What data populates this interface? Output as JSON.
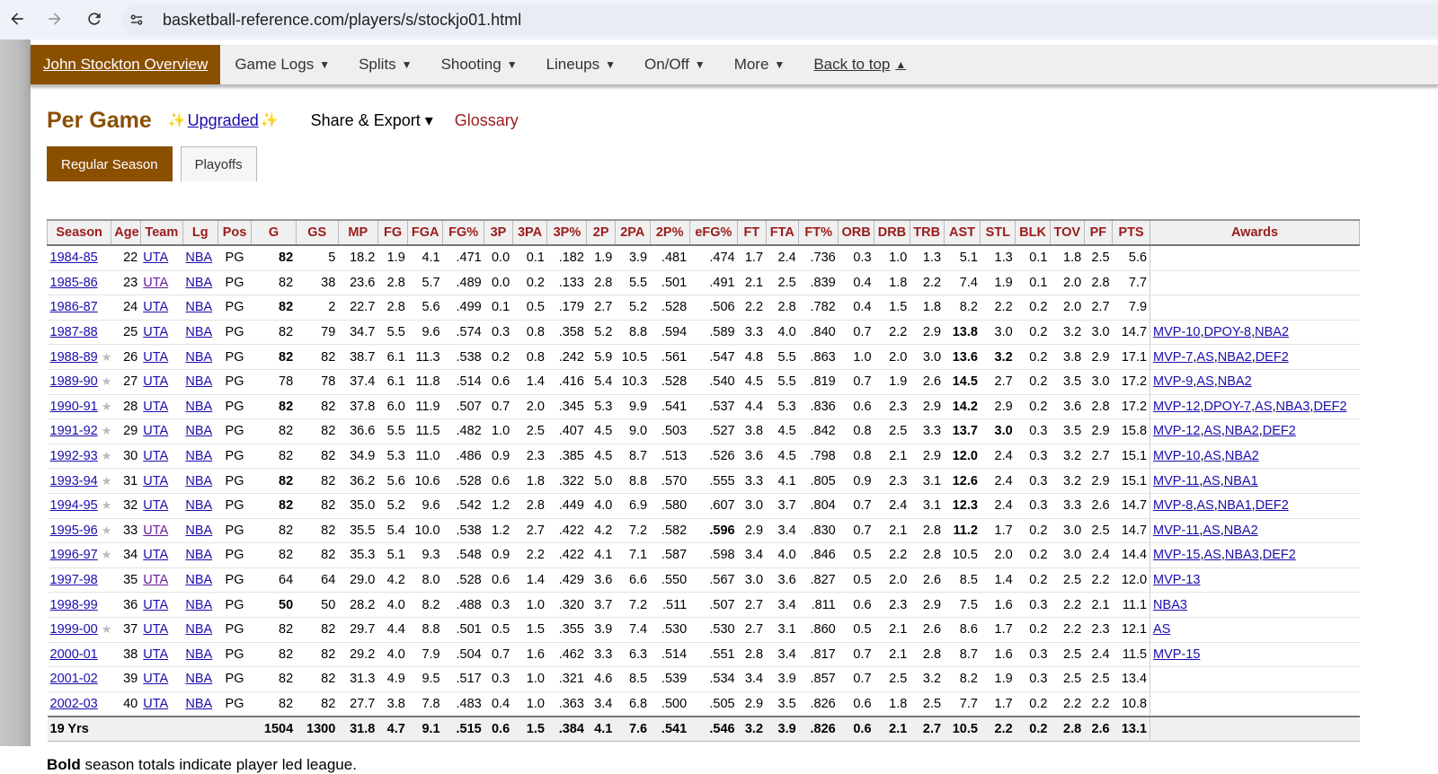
{
  "browser": {
    "url": "basketball-reference.com/players/s/stockjo01.html"
  },
  "subnav": [
    {
      "label": "John Stockton Overview",
      "caret": ""
    },
    {
      "label": "Game Logs",
      "caret": "▼"
    },
    {
      "label": "Splits",
      "caret": "▼"
    },
    {
      "label": "Shooting",
      "caret": "▼"
    },
    {
      "label": "Lineups",
      "caret": "▼"
    },
    {
      "label": "On/Off",
      "caret": "▼"
    },
    {
      "label": "More",
      "caret": "▼"
    },
    {
      "label": "Back to top",
      "caret": "▲"
    }
  ],
  "heading": {
    "title": "Per Game",
    "upgraded": "Upgraded",
    "share": "Share & Export ▾",
    "glossary": "Glossary"
  },
  "tabs": {
    "regular": "Regular Season",
    "playoffs": "Playoffs"
  },
  "columns": [
    "Season",
    "Age",
    "Team",
    "Lg",
    "Pos",
    "G",
    "GS",
    "MP",
    "FG",
    "FGA",
    "FG%",
    "3P",
    "3PA",
    "3P%",
    "2P",
    "2PA",
    "2P%",
    "eFG%",
    "FT",
    "FTA",
    "FT%",
    "ORB",
    "DRB",
    "TRB",
    "AST",
    "STL",
    "BLK",
    "TOV",
    "PF",
    "PTS",
    "Awards"
  ],
  "rows": [
    {
      "season": "1984-85",
      "star": false,
      "age": "22",
      "team": "UTA",
      "tv": false,
      "lg": "NBA",
      "pos": "PG",
      "g": "82",
      "gs": "5",
      "mp": "18.2",
      "fg": "1.9",
      "fga": "4.1",
      "fgp": ".471",
      "p3": "0.0",
      "pa3": "0.1",
      "pp3": ".182",
      "p2": "1.9",
      "pa2": "3.9",
      "pp2": ".481",
      "efg": ".474",
      "ft": "1.7",
      "fta": "2.4",
      "ftp": ".736",
      "orb": "0.3",
      "drb": "1.0",
      "trb": "1.3",
      "ast": "5.1",
      "stl": "1.3",
      "blk": "0.1",
      "tov": "1.8",
      "pf": "2.5",
      "pts": "5.6",
      "awards": [],
      "bold": [
        "g"
      ]
    },
    {
      "season": "1985-86",
      "star": false,
      "age": "23",
      "team": "UTA",
      "tv": true,
      "lg": "NBA",
      "pos": "PG",
      "g": "82",
      "gs": "38",
      "mp": "23.6",
      "fg": "2.8",
      "fga": "5.7",
      "fgp": ".489",
      "p3": "0.0",
      "pa3": "0.2",
      "pp3": ".133",
      "p2": "2.8",
      "pa2": "5.5",
      "pp2": ".501",
      "efg": ".491",
      "ft": "2.1",
      "fta": "2.5",
      "ftp": ".839",
      "orb": "0.4",
      "drb": "1.8",
      "trb": "2.2",
      "ast": "7.4",
      "stl": "1.9",
      "blk": "0.1",
      "tov": "2.0",
      "pf": "2.8",
      "pts": "7.7",
      "awards": [],
      "bold": []
    },
    {
      "season": "1986-87",
      "star": false,
      "age": "24",
      "team": "UTA",
      "tv": false,
      "lg": "NBA",
      "pos": "PG",
      "g": "82",
      "gs": "2",
      "mp": "22.7",
      "fg": "2.8",
      "fga": "5.6",
      "fgp": ".499",
      "p3": "0.1",
      "pa3": "0.5",
      "pp3": ".179",
      "p2": "2.7",
      "pa2": "5.2",
      "pp2": ".528",
      "efg": ".506",
      "ft": "2.2",
      "fta": "2.8",
      "ftp": ".782",
      "orb": "0.4",
      "drb": "1.5",
      "trb": "1.8",
      "ast": "8.2",
      "stl": "2.2",
      "blk": "0.2",
      "tov": "2.0",
      "pf": "2.7",
      "pts": "7.9",
      "awards": [],
      "bold": [
        "g"
      ]
    },
    {
      "season": "1987-88",
      "star": false,
      "age": "25",
      "team": "UTA",
      "tv": false,
      "lg": "NBA",
      "pos": "PG",
      "g": "82",
      "gs": "79",
      "mp": "34.7",
      "fg": "5.5",
      "fga": "9.6",
      "fgp": ".574",
      "p3": "0.3",
      "pa3": "0.8",
      "pp3": ".358",
      "p2": "5.2",
      "pa2": "8.8",
      "pp2": ".594",
      "efg": ".589",
      "ft": "3.3",
      "fta": "4.0",
      "ftp": ".840",
      "orb": "0.7",
      "drb": "2.2",
      "trb": "2.9",
      "ast": "13.8",
      "stl": "3.0",
      "blk": "0.2",
      "tov": "3.2",
      "pf": "3.0",
      "pts": "14.7",
      "awards": [
        "MVP-10",
        "DPOY-8",
        "NBA2"
      ],
      "bold": [
        "ast"
      ]
    },
    {
      "season": "1988-89",
      "star": true,
      "age": "26",
      "team": "UTA",
      "tv": false,
      "lg": "NBA",
      "pos": "PG",
      "g": "82",
      "gs": "82",
      "mp": "38.7",
      "fg": "6.1",
      "fga": "11.3",
      "fgp": ".538",
      "p3": "0.2",
      "pa3": "0.8",
      "pp3": ".242",
      "p2": "5.9",
      "pa2": "10.5",
      "pp2": ".561",
      "efg": ".547",
      "ft": "4.8",
      "fta": "5.5",
      "ftp": ".863",
      "orb": "1.0",
      "drb": "2.0",
      "trb": "3.0",
      "ast": "13.6",
      "stl": "3.2",
      "blk": "0.2",
      "tov": "3.8",
      "pf": "2.9",
      "pts": "17.1",
      "awards": [
        "MVP-7",
        "AS",
        "NBA2",
        "DEF2"
      ],
      "bold": [
        "g",
        "ast",
        "stl"
      ]
    },
    {
      "season": "1989-90",
      "star": true,
      "age": "27",
      "team": "UTA",
      "tv": false,
      "lg": "NBA",
      "pos": "PG",
      "g": "78",
      "gs": "78",
      "mp": "37.4",
      "fg": "6.1",
      "fga": "11.8",
      "fgp": ".514",
      "p3": "0.6",
      "pa3": "1.4",
      "pp3": ".416",
      "p2": "5.4",
      "pa2": "10.3",
      "pp2": ".528",
      "efg": ".540",
      "ft": "4.5",
      "fta": "5.5",
      "ftp": ".819",
      "orb": "0.7",
      "drb": "1.9",
      "trb": "2.6",
      "ast": "14.5",
      "stl": "2.7",
      "blk": "0.2",
      "tov": "3.5",
      "pf": "3.0",
      "pts": "17.2",
      "awards": [
        "MVP-9",
        "AS",
        "NBA2"
      ],
      "bold": [
        "ast"
      ]
    },
    {
      "season": "1990-91",
      "star": true,
      "age": "28",
      "team": "UTA",
      "tv": false,
      "lg": "NBA",
      "pos": "PG",
      "g": "82",
      "gs": "82",
      "mp": "37.8",
      "fg": "6.0",
      "fga": "11.9",
      "fgp": ".507",
      "p3": "0.7",
      "pa3": "2.0",
      "pp3": ".345",
      "p2": "5.3",
      "pa2": "9.9",
      "pp2": ".541",
      "efg": ".537",
      "ft": "4.4",
      "fta": "5.3",
      "ftp": ".836",
      "orb": "0.6",
      "drb": "2.3",
      "trb": "2.9",
      "ast": "14.2",
      "stl": "2.9",
      "blk": "0.2",
      "tov": "3.6",
      "pf": "2.8",
      "pts": "17.2",
      "awards": [
        "MVP-12",
        "DPOY-7",
        "AS",
        "NBA3",
        "DEF2"
      ],
      "bold": [
        "g",
        "ast"
      ]
    },
    {
      "season": "1991-92",
      "star": true,
      "age": "29",
      "team": "UTA",
      "tv": false,
      "lg": "NBA",
      "pos": "PG",
      "g": "82",
      "gs": "82",
      "mp": "36.6",
      "fg": "5.5",
      "fga": "11.5",
      "fgp": ".482",
      "p3": "1.0",
      "pa3": "2.5",
      "pp3": ".407",
      "p2": "4.5",
      "pa2": "9.0",
      "pp2": ".503",
      "efg": ".527",
      "ft": "3.8",
      "fta": "4.5",
      "ftp": ".842",
      "orb": "0.8",
      "drb": "2.5",
      "trb": "3.3",
      "ast": "13.7",
      "stl": "3.0",
      "blk": "0.3",
      "tov": "3.5",
      "pf": "2.9",
      "pts": "15.8",
      "awards": [
        "MVP-12",
        "AS",
        "NBA2",
        "DEF2"
      ],
      "bold": [
        "ast",
        "stl"
      ]
    },
    {
      "season": "1992-93",
      "star": true,
      "age": "30",
      "team": "UTA",
      "tv": false,
      "lg": "NBA",
      "pos": "PG",
      "g": "82",
      "gs": "82",
      "mp": "34.9",
      "fg": "5.3",
      "fga": "11.0",
      "fgp": ".486",
      "p3": "0.9",
      "pa3": "2.3",
      "pp3": ".385",
      "p2": "4.5",
      "pa2": "8.7",
      "pp2": ".513",
      "efg": ".526",
      "ft": "3.6",
      "fta": "4.5",
      "ftp": ".798",
      "orb": "0.8",
      "drb": "2.1",
      "trb": "2.9",
      "ast": "12.0",
      "stl": "2.4",
      "blk": "0.3",
      "tov": "3.2",
      "pf": "2.7",
      "pts": "15.1",
      "awards": [
        "MVP-10",
        "AS",
        "NBA2"
      ],
      "bold": [
        "ast"
      ]
    },
    {
      "season": "1993-94",
      "star": true,
      "age": "31",
      "team": "UTA",
      "tv": false,
      "lg": "NBA",
      "pos": "PG",
      "g": "82",
      "gs": "82",
      "mp": "36.2",
      "fg": "5.6",
      "fga": "10.6",
      "fgp": ".528",
      "p3": "0.6",
      "pa3": "1.8",
      "pp3": ".322",
      "p2": "5.0",
      "pa2": "8.8",
      "pp2": ".570",
      "efg": ".555",
      "ft": "3.3",
      "fta": "4.1",
      "ftp": ".805",
      "orb": "0.9",
      "drb": "2.3",
      "trb": "3.1",
      "ast": "12.6",
      "stl": "2.4",
      "blk": "0.3",
      "tov": "3.2",
      "pf": "2.9",
      "pts": "15.1",
      "awards": [
        "MVP-11",
        "AS",
        "NBA1"
      ],
      "bold": [
        "g",
        "ast"
      ]
    },
    {
      "season": "1994-95",
      "star": true,
      "age": "32",
      "team": "UTA",
      "tv": false,
      "lg": "NBA",
      "pos": "PG",
      "g": "82",
      "gs": "82",
      "mp": "35.0",
      "fg": "5.2",
      "fga": "9.6",
      "fgp": ".542",
      "p3": "1.2",
      "pa3": "2.8",
      "pp3": ".449",
      "p2": "4.0",
      "pa2": "6.9",
      "pp2": ".580",
      "efg": ".607",
      "ft": "3.0",
      "fta": "3.7",
      "ftp": ".804",
      "orb": "0.7",
      "drb": "2.4",
      "trb": "3.1",
      "ast": "12.3",
      "stl": "2.4",
      "blk": "0.3",
      "tov": "3.3",
      "pf": "2.6",
      "pts": "14.7",
      "awards": [
        "MVP-8",
        "AS",
        "NBA1",
        "DEF2"
      ],
      "bold": [
        "g",
        "ast"
      ]
    },
    {
      "season": "1995-96",
      "star": true,
      "age": "33",
      "team": "UTA",
      "tv": true,
      "lg": "NBA",
      "pos": "PG",
      "g": "82",
      "gs": "82",
      "mp": "35.5",
      "fg": "5.4",
      "fga": "10.0",
      "fgp": ".538",
      "p3": "1.2",
      "pa3": "2.7",
      "pp3": ".422",
      "p2": "4.2",
      "pa2": "7.2",
      "pp2": ".582",
      "efg": ".596",
      "ft": "2.9",
      "fta": "3.4",
      "ftp": ".830",
      "orb": "0.7",
      "drb": "2.1",
      "trb": "2.8",
      "ast": "11.2",
      "stl": "1.7",
      "blk": "0.2",
      "tov": "3.0",
      "pf": "2.5",
      "pts": "14.7",
      "awards": [
        "MVP-11",
        "AS",
        "NBA2"
      ],
      "bold": [
        "efg",
        "ast"
      ]
    },
    {
      "season": "1996-97",
      "star": true,
      "age": "34",
      "team": "UTA",
      "tv": false,
      "lg": "NBA",
      "pos": "PG",
      "g": "82",
      "gs": "82",
      "mp": "35.3",
      "fg": "5.1",
      "fga": "9.3",
      "fgp": ".548",
      "p3": "0.9",
      "pa3": "2.2",
      "pp3": ".422",
      "p2": "4.1",
      "pa2": "7.1",
      "pp2": ".587",
      "efg": ".598",
      "ft": "3.4",
      "fta": "4.0",
      "ftp": ".846",
      "orb": "0.5",
      "drb": "2.2",
      "trb": "2.8",
      "ast": "10.5",
      "stl": "2.0",
      "blk": "0.2",
      "tov": "3.0",
      "pf": "2.4",
      "pts": "14.4",
      "awards": [
        "MVP-15",
        "AS",
        "NBA3",
        "DEF2"
      ],
      "bold": []
    },
    {
      "season": "1997-98",
      "star": false,
      "age": "35",
      "team": "UTA",
      "tv": true,
      "lg": "NBA",
      "pos": "PG",
      "g": "64",
      "gs": "64",
      "mp": "29.0",
      "fg": "4.2",
      "fga": "8.0",
      "fgp": ".528",
      "p3": "0.6",
      "pa3": "1.4",
      "pp3": ".429",
      "p2": "3.6",
      "pa2": "6.6",
      "pp2": ".550",
      "efg": ".567",
      "ft": "3.0",
      "fta": "3.6",
      "ftp": ".827",
      "orb": "0.5",
      "drb": "2.0",
      "trb": "2.6",
      "ast": "8.5",
      "stl": "1.4",
      "blk": "0.2",
      "tov": "2.5",
      "pf": "2.2",
      "pts": "12.0",
      "awards": [
        "MVP-13"
      ],
      "bold": []
    },
    {
      "season": "1998-99",
      "star": false,
      "age": "36",
      "team": "UTA",
      "tv": false,
      "lg": "NBA",
      "pos": "PG",
      "g": "50",
      "gs": "50",
      "mp": "28.2",
      "fg": "4.0",
      "fga": "8.2",
      "fgp": ".488",
      "p3": "0.3",
      "pa3": "1.0",
      "pp3": ".320",
      "p2": "3.7",
      "pa2": "7.2",
      "pp2": ".511",
      "efg": ".507",
      "ft": "2.7",
      "fta": "3.4",
      "ftp": ".811",
      "orb": "0.6",
      "drb": "2.3",
      "trb": "2.9",
      "ast": "7.5",
      "stl": "1.6",
      "blk": "0.3",
      "tov": "2.2",
      "pf": "2.1",
      "pts": "11.1",
      "awards": [
        "NBA3"
      ],
      "bold": [
        "g"
      ]
    },
    {
      "season": "1999-00",
      "star": true,
      "age": "37",
      "team": "UTA",
      "tv": false,
      "lg": "NBA",
      "pos": "PG",
      "g": "82",
      "gs": "82",
      "mp": "29.7",
      "fg": "4.4",
      "fga": "8.8",
      "fgp": ".501",
      "p3": "0.5",
      "pa3": "1.5",
      "pp3": ".355",
      "p2": "3.9",
      "pa2": "7.4",
      "pp2": ".530",
      "efg": ".530",
      "ft": "2.7",
      "fta": "3.1",
      "ftp": ".860",
      "orb": "0.5",
      "drb": "2.1",
      "trb": "2.6",
      "ast": "8.6",
      "stl": "1.7",
      "blk": "0.2",
      "tov": "2.2",
      "pf": "2.3",
      "pts": "12.1",
      "awards": [
        "AS"
      ],
      "bold": []
    },
    {
      "season": "2000-01",
      "star": false,
      "age": "38",
      "team": "UTA",
      "tv": false,
      "lg": "NBA",
      "pos": "PG",
      "g": "82",
      "gs": "82",
      "mp": "29.2",
      "fg": "4.0",
      "fga": "7.9",
      "fgp": ".504",
      "p3": "0.7",
      "pa3": "1.6",
      "pp3": ".462",
      "p2": "3.3",
      "pa2": "6.3",
      "pp2": ".514",
      "efg": ".551",
      "ft": "2.8",
      "fta": "3.4",
      "ftp": ".817",
      "orb": "0.7",
      "drb": "2.1",
      "trb": "2.8",
      "ast": "8.7",
      "stl": "1.6",
      "blk": "0.3",
      "tov": "2.5",
      "pf": "2.4",
      "pts": "11.5",
      "awards": [
        "MVP-15"
      ],
      "bold": []
    },
    {
      "season": "2001-02",
      "star": false,
      "age": "39",
      "team": "UTA",
      "tv": false,
      "lg": "NBA",
      "pos": "PG",
      "g": "82",
      "gs": "82",
      "mp": "31.3",
      "fg": "4.9",
      "fga": "9.5",
      "fgp": ".517",
      "p3": "0.3",
      "pa3": "1.0",
      "pp3": ".321",
      "p2": "4.6",
      "pa2": "8.5",
      "pp2": ".539",
      "efg": ".534",
      "ft": "3.4",
      "fta": "3.9",
      "ftp": ".857",
      "orb": "0.7",
      "drb": "2.5",
      "trb": "3.2",
      "ast": "8.2",
      "stl": "1.9",
      "blk": "0.3",
      "tov": "2.5",
      "pf": "2.5",
      "pts": "13.4",
      "awards": [],
      "bold": []
    },
    {
      "season": "2002-03",
      "star": false,
      "age": "40",
      "team": "UTA",
      "tv": false,
      "lg": "NBA",
      "pos": "PG",
      "g": "82",
      "gs": "82",
      "mp": "27.7",
      "fg": "3.8",
      "fga": "7.8",
      "fgp": ".483",
      "p3": "0.4",
      "pa3": "1.0",
      "pp3": ".363",
      "p2": "3.4",
      "pa2": "6.8",
      "pp2": ".500",
      "efg": ".505",
      "ft": "2.9",
      "fta": "3.5",
      "ftp": ".826",
      "orb": "0.6",
      "drb": "1.8",
      "trb": "2.5",
      "ast": "7.7",
      "stl": "1.7",
      "blk": "0.2",
      "tov": "2.2",
      "pf": "2.2",
      "pts": "10.8",
      "awards": [],
      "bold": []
    }
  ],
  "totals": {
    "label": "19 Yrs",
    "g": "1504",
    "gs": "1300",
    "mp": "31.8",
    "fg": "4.7",
    "fga": "9.1",
    "fgp": ".515",
    "p3": "0.6",
    "pa3": "1.5",
    "pp3": ".384",
    "p2": "4.1",
    "pa2": "7.6",
    "pp2": ".541",
    "efg": ".546",
    "ft": "3.2",
    "fta": "3.9",
    "ftp": ".826",
    "orb": "0.6",
    "drb": "2.1",
    "trb": "2.7",
    "ast": "10.5",
    "stl": "2.2",
    "blk": "0.2",
    "tov": "2.8",
    "pf": "2.6",
    "pts": "13.1"
  },
  "note": {
    "bold": "Bold",
    "rest": " season totals indicate player led league."
  },
  "colors": {
    "accent": "#8b4f00",
    "header_text": "#9b1c1c",
    "link": "#1a0dab",
    "visited": "#6a1b9a"
  }
}
